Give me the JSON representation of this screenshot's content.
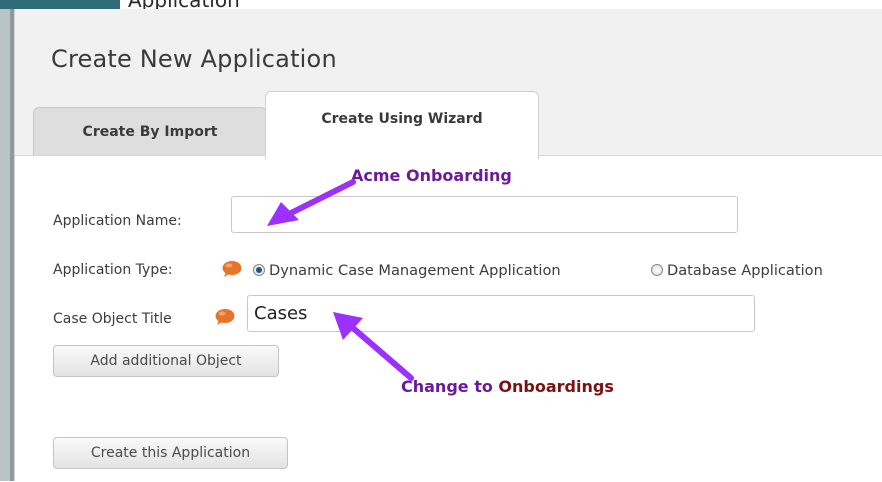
{
  "background_window": {
    "partial_title": "Application"
  },
  "dialog": {
    "title": "Create New Application",
    "tabs": [
      {
        "label": "Create By Import",
        "active": false
      },
      {
        "label": "Create Using Wizard",
        "active": true
      }
    ],
    "form": {
      "application_name": {
        "label": "Application Name:",
        "value": ""
      },
      "application_type": {
        "label": "Application Type:",
        "options": [
          {
            "label": "Dynamic Case Management Application",
            "selected": true
          },
          {
            "label": "Database Application",
            "selected": false
          }
        ]
      },
      "case_object_title": {
        "label": "Case Object Title",
        "value": "Cases"
      },
      "add_object_button": "Add additional Object",
      "create_button": "Create this Application"
    }
  },
  "annotations": {
    "name_hint": "Acme Onboarding",
    "title_hint_prefix": "Change to ",
    "title_hint_value": "Onboardings"
  },
  "colors": {
    "annotation_purple": "#6b1a9a",
    "annotation_dark_red": "#7a1212",
    "arrow": "#9b30ff",
    "help_bubble": "#e8732a",
    "header_strip": "#2f6a78"
  },
  "icons": {
    "help": "speech-bubble-icon",
    "arrow": "annotation-arrow-icon"
  }
}
